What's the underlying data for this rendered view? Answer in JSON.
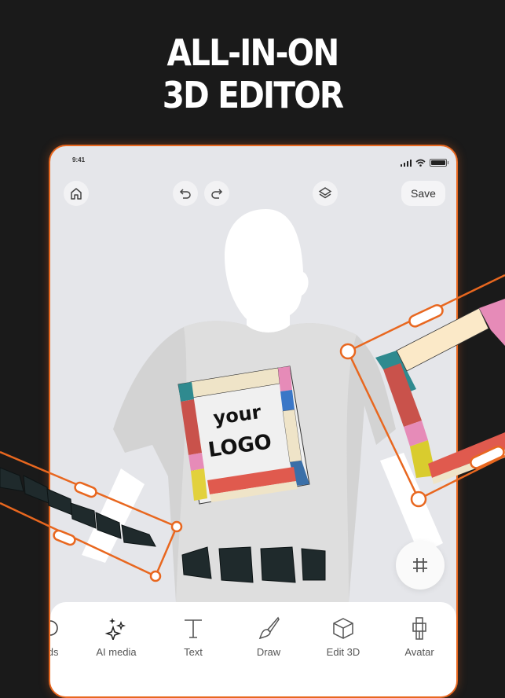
{
  "headline": {
    "line1": "ALL-IN-ON",
    "line2": "3D EDITOR"
  },
  "status_bar": {
    "time": "9:41"
  },
  "top_bar": {
    "save_label": "Save"
  },
  "canvas": {
    "logo_line1": "your",
    "logo_line2": "LOGO"
  },
  "toolbar": {
    "items": [
      {
        "label": "ads",
        "icon": "upload-icon"
      },
      {
        "label": "AI media",
        "icon": "sparkles-icon"
      },
      {
        "label": "Text",
        "icon": "text-icon"
      },
      {
        "label": "Draw",
        "icon": "brush-icon"
      },
      {
        "label": "Edit 3D",
        "icon": "cube-icon"
      },
      {
        "label": "Avatar",
        "icon": "avatar-icon"
      }
    ]
  },
  "colors": {
    "accent": "#e8671f",
    "background": "#1a1a1a",
    "canvas": "#e5e6ea"
  }
}
